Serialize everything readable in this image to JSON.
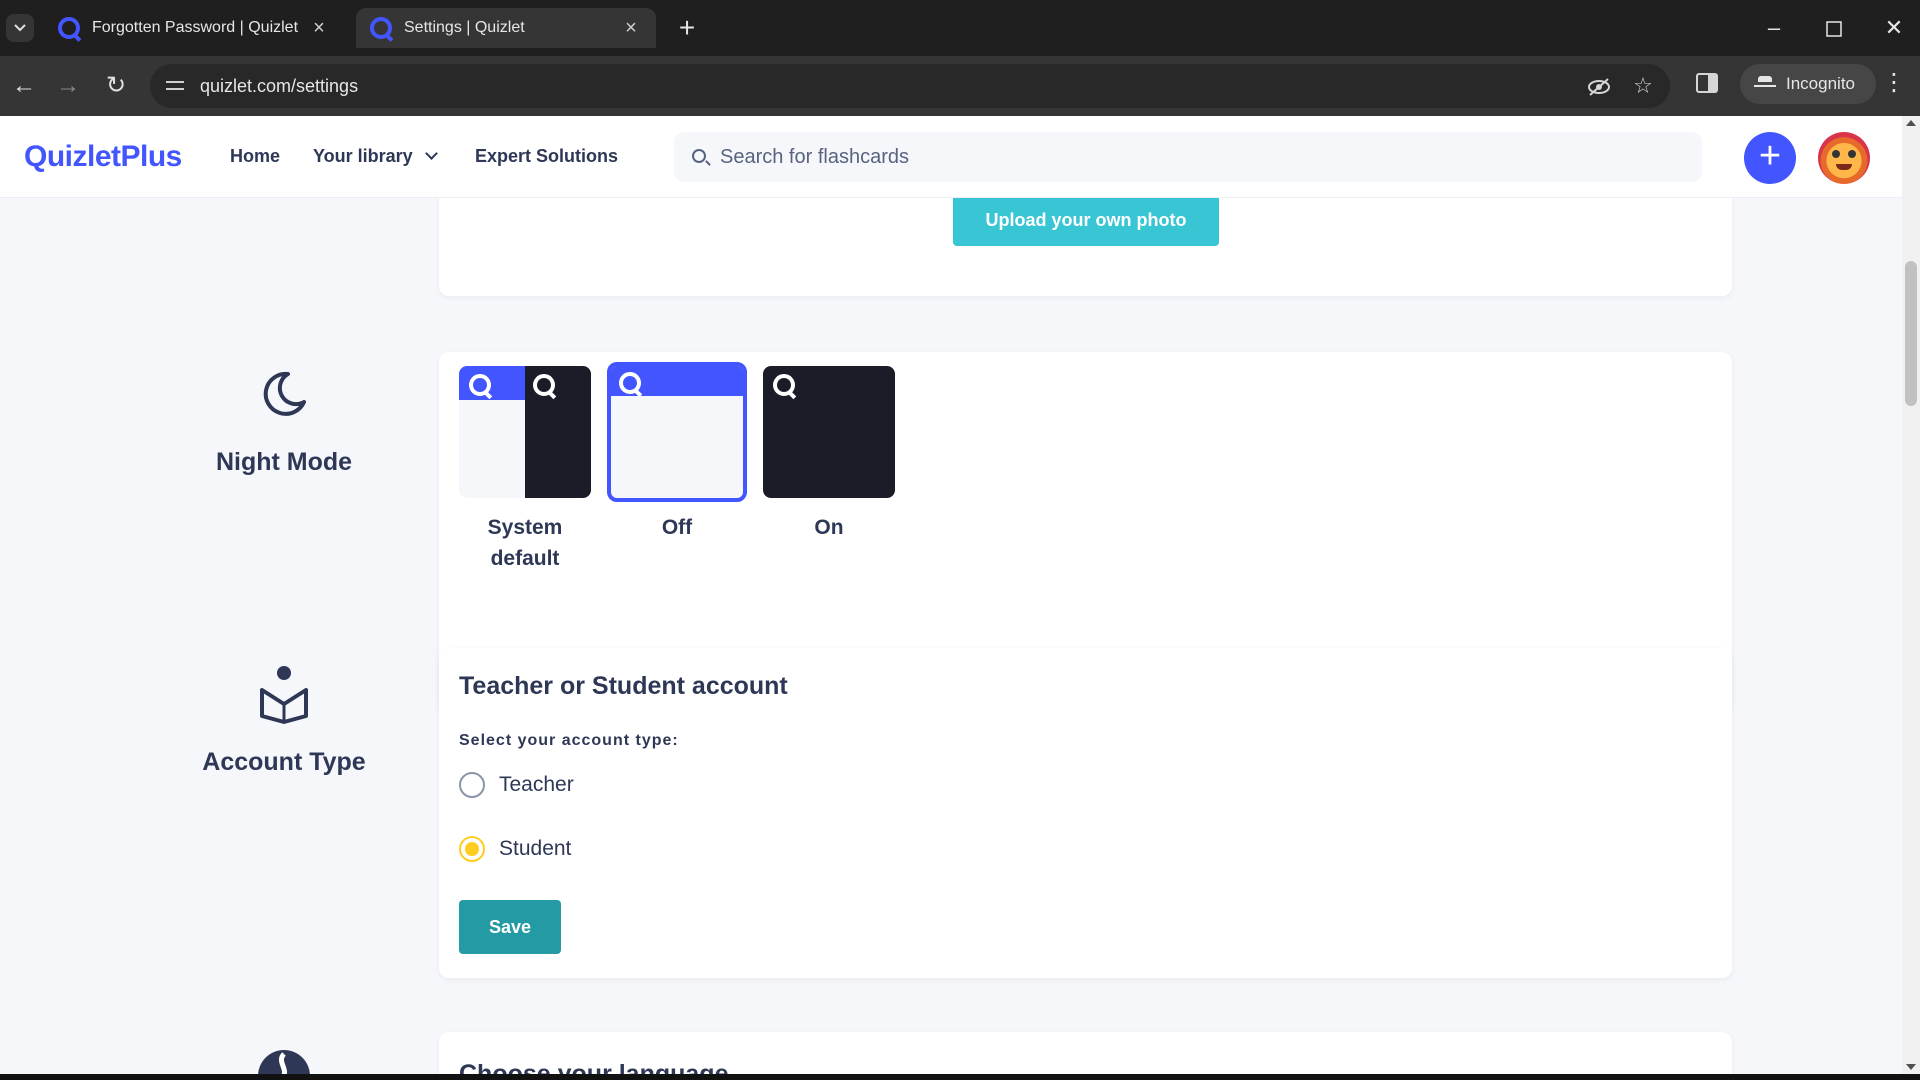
{
  "browser": {
    "tabs": [
      {
        "title": "Forgotten Password | Quizlet",
        "active": false
      },
      {
        "title": "Settings | Quizlet",
        "active": true
      }
    ],
    "new_tab_symbol": "+",
    "close_symbol": "×",
    "url": "quizlet.com/settings",
    "incognito_label": "Incognito"
  },
  "site": {
    "logo": "QuizletPlus",
    "nav": {
      "home": "Home",
      "library": "Your library",
      "expert": "Expert Solutions"
    },
    "search_placeholder": "Search for flashcards",
    "create_symbol": "+"
  },
  "profile_photo": {
    "upload_label": "Upload your own photo"
  },
  "night_mode": {
    "label": "Night Mode",
    "options": [
      {
        "label": "System default",
        "selected": false
      },
      {
        "label": "Off",
        "selected": true
      },
      {
        "label": "On",
        "selected": false
      }
    ]
  },
  "account_type": {
    "label": "Account Type",
    "title": "Teacher or Student account",
    "field_label": "Select your account type:",
    "options": [
      {
        "label": "Teacher",
        "checked": false
      },
      {
        "label": "Student",
        "checked": true
      }
    ],
    "save_label": "Save"
  },
  "language": {
    "title": "Choose your language"
  },
  "colors": {
    "brand": "#4255ff",
    "upload": "#38c6d4",
    "save": "#239aa4",
    "radio_checked": "#ffcd1f",
    "text": "#2e3856"
  }
}
